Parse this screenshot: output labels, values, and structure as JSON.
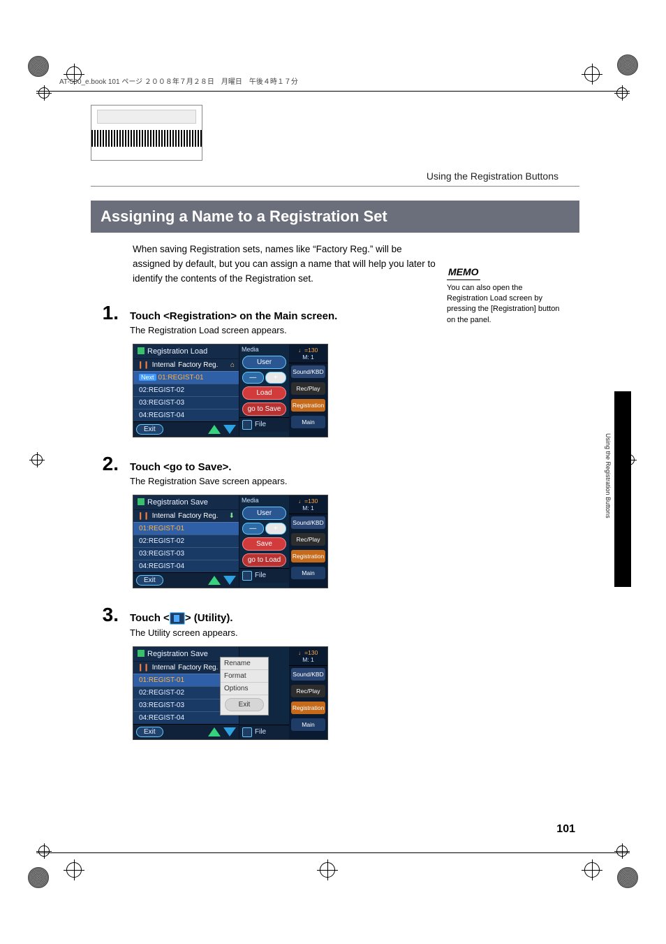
{
  "header_line": "AT-500_e.book  101 ページ  ２００８年７月２８日　月曜日　午後４時１７分",
  "section_label": "Using the Registration Buttons",
  "banner": "Assigning a Name to a Registration Set",
  "intro": "When saving Registration sets, names like “Factory Reg.” will be assigned by default, but you can assign a name that will help you later to identify the contents of the Registration set.",
  "steps": [
    {
      "n": "1.",
      "title": "Touch <Registration> on the Main screen.",
      "desc": "The Registration Load screen appears."
    },
    {
      "n": "2.",
      "title": "Touch <go to Save>.",
      "desc": "The Registration Save screen appears."
    },
    {
      "n": "3.",
      "title_prefix": "Touch <",
      "title_suffix": "> (Utility).",
      "desc": "The Utility screen appears."
    }
  ],
  "memo_title": "MEMO",
  "memo_body": "You can also open the Registration Load screen by pressing the [Registration] button on the panel.",
  "side_tab_text": "Using the Registration Buttons",
  "page_number": "101",
  "screens": {
    "common_side": {
      "tempo": "♩=130",
      "measure": "M:   1",
      "sound": "Sound/KBD",
      "rec": "Rec/Play",
      "reg": "Registration",
      "main": "Main"
    },
    "list_rows": [
      "01:REGIST-01",
      "02:REGIST-02",
      "03:REGIST-03",
      "04:REGIST-04"
    ],
    "internal_label": "Internal",
    "internal_name": "Factory Reg.",
    "media_label": "Media",
    "user_btn": "User",
    "exit": "Exit",
    "file": "File",
    "next": "Next",
    "s1": {
      "title": "Registration Load",
      "load": "Load",
      "go": "go to Save"
    },
    "s2": {
      "title": "Registration Save",
      "save": "Save",
      "go": "go to Load"
    },
    "s3": {
      "title": "Registration Save",
      "util": {
        "rename": "Rename",
        "format": "Format",
        "options": "Options",
        "exit": "Exit"
      }
    }
  }
}
